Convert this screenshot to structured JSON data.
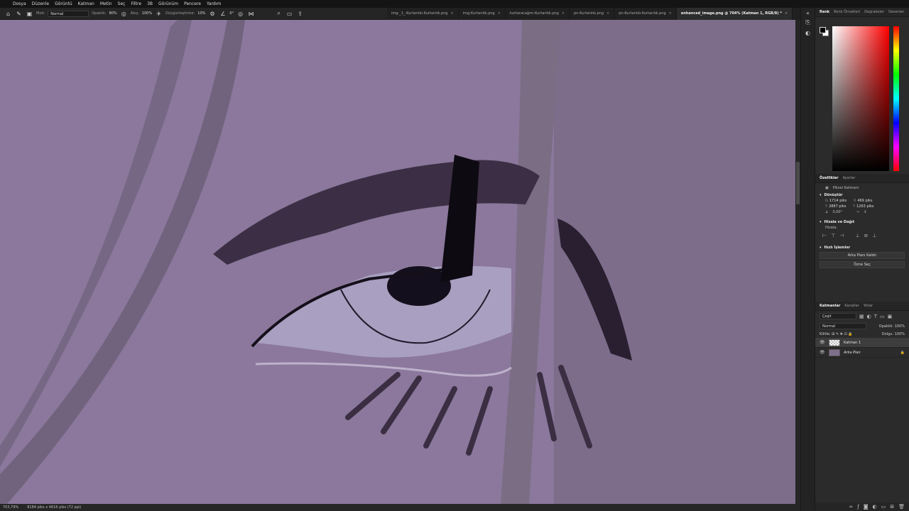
{
  "menu": [
    "Dosya",
    "Düzenle",
    "Görüntü",
    "Katman",
    "Metin",
    "Seç",
    "Filtre",
    "3B",
    "Görünüm",
    "Pencere",
    "Yardım"
  ],
  "options": {
    "mode_label": "Mod:",
    "mode_value": "Normal",
    "opacity_label": "Opaklık:",
    "opacity_value": "80%",
    "flow_label": "Akış:",
    "flow_value": "100%",
    "smoothing_label": "Düzgünleştirme:",
    "smoothing_value": "10%",
    "angle_value": "0°"
  },
  "tabs": [
    {
      "label": "img-_1_-Kurtarıldı-Kurtarıldı.png",
      "active": false
    },
    {
      "label": "img-Kurtarıldı.png",
      "active": false
    },
    {
      "label": "kurtaracağım-Kurtarıldı.png",
      "active": false
    },
    {
      "label": "pn-Kurtarıldı.png",
      "active": false
    },
    {
      "label": "pn-Kurtarıldı-Kurtarıldı.png",
      "active": false
    },
    {
      "label": "enhanced_image.png @ 704% (Katman 1, RGB/8) *",
      "active": true
    }
  ],
  "status": {
    "zoom": "703,79%",
    "doc_size": "8184 piks x 4616 piks (72 ppi)"
  },
  "panel": {
    "color_tabs": [
      "Renk",
      "Renk Örnekleri",
      "Degradeler",
      "Desenler"
    ],
    "props_tabs": [
      "Özellikler",
      "Ayarlar"
    ],
    "pixel_layer": "Piksel Katmanı",
    "transform_title": "Dönüştür",
    "w_label": "G",
    "w_value": "1714 piks",
    "h_label": "Y",
    "h_value": "2887 piks",
    "x_label": "X",
    "x_value": "469 piks",
    "y_label": "Y",
    "y_value": "1263 piks",
    "angle_value": "0,00°",
    "align_title": "Hizala ve Dağıt",
    "align_sub": "Hizala:",
    "quick_title": "Hızlı İşlemler",
    "remove_bg": "Arka Planı Kaldır",
    "select_subject": "Özne Seç",
    "layer_tabs": [
      "Katmanlar",
      "Kanallar",
      "Yollar"
    ],
    "filter_value": "Çeşit",
    "blend_value": "Normal",
    "opacity_label": "Opaklık:",
    "opacity_value": "100%",
    "lock_label": "Kilitle:",
    "fill_label": "Dolgu:",
    "fill_value": "100%",
    "layers": [
      {
        "name": "Katman 1",
        "selected": true
      },
      {
        "name": "Arka Plan",
        "selected": false
      }
    ]
  }
}
